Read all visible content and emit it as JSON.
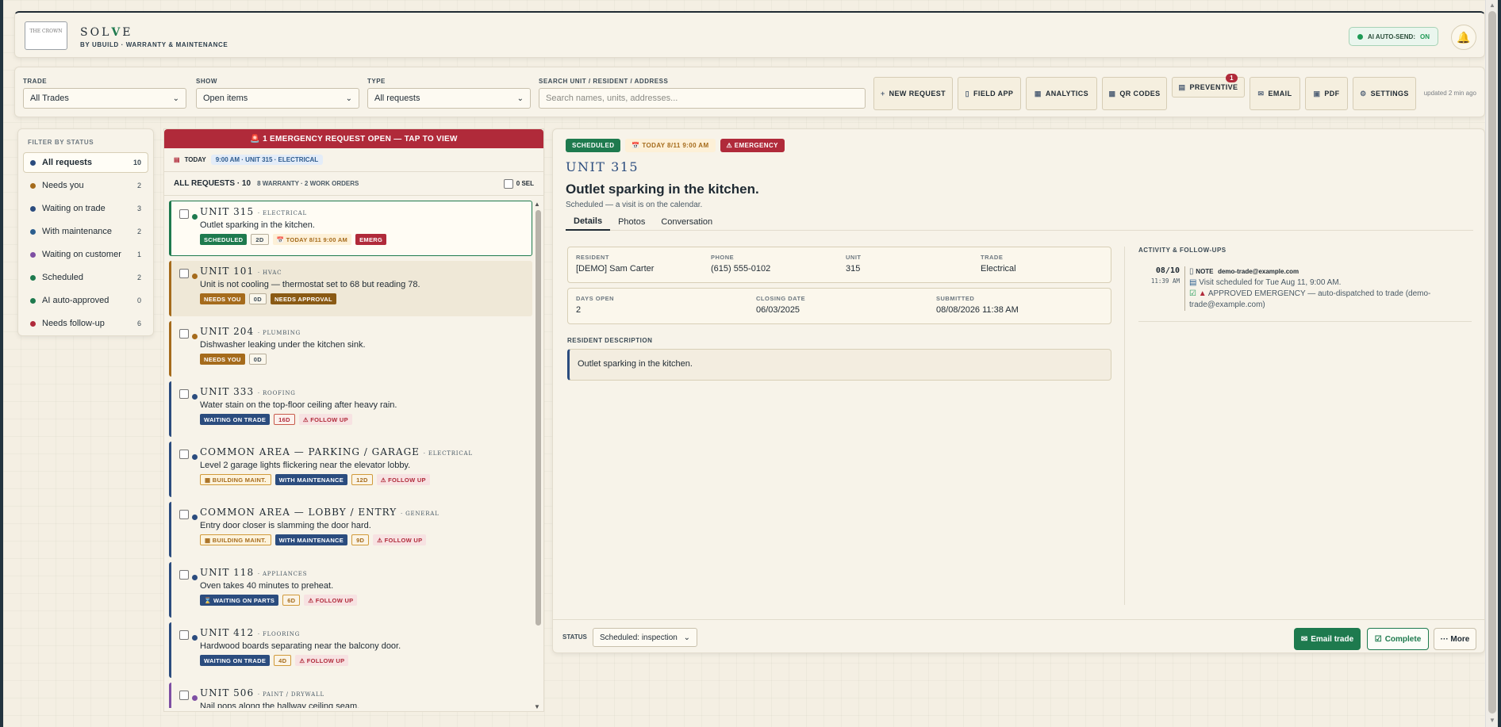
{
  "header": {
    "logo_text": "THE CROWN",
    "brand_prefix": "SOL",
    "brand_mark": "V",
    "brand_suffix": "E",
    "tagline": "BY UBUILD · WARRANTY & MAINTENANCE",
    "ai_label": "AI AUTO-SEND:",
    "ai_state": "ON",
    "bell_icon": "bell-icon"
  },
  "filters": {
    "trade_label": "TRADE",
    "trade_value": "All Trades",
    "show_label": "SHOW",
    "show_value": "Open items",
    "type_label": "TYPE",
    "type_value": "All requests",
    "search_label": "SEARCH UNIT / RESIDENT / ADDRESS",
    "search_placeholder": "Search names, units, addresses..."
  },
  "toolbar": {
    "new_request": "NEW REQUEST",
    "field_app": "FIELD APP",
    "analytics": "ANALYTICS",
    "qr_codes": "QR CODES",
    "preventive": "PREVENTIVE",
    "preventive_badge": "1",
    "email": "EMAIL",
    "pdf": "PDF",
    "settings": "SETTINGS",
    "updated": "updated 2 min ago"
  },
  "status_filter": {
    "title": "FILTER BY STATUS",
    "items": [
      {
        "label": "All requests",
        "count": "10",
        "color": "#2b4c7e"
      },
      {
        "label": "Needs you",
        "count": "2",
        "color": "#a56b1c"
      },
      {
        "label": "Waiting on trade",
        "count": "3",
        "color": "#2b4c7e"
      },
      {
        "label": "With maintenance",
        "count": "2",
        "color": "#2b5e8e"
      },
      {
        "label": "Waiting on customer",
        "count": "1",
        "color": "#7e4fa3"
      },
      {
        "label": "Scheduled",
        "count": "2",
        "color": "#1e7a4e"
      },
      {
        "label": "AI auto-approved",
        "count": "0",
        "color": "#1e7a4e"
      },
      {
        "label": "Needs follow-up",
        "count": "6",
        "color": "#b02a3a"
      }
    ]
  },
  "list": {
    "emergency_banner": "1 EMERGENCY REQUEST OPEN — TAP TO VIEW",
    "today_label": "TODAY",
    "today_chip": "9:00 AM · UNIT 315 · ELECTRICAL",
    "all_label": "ALL REQUESTS · 10",
    "all_sub": "8 WARRANTY · 2 WORK ORDERS",
    "sel_label": "0 SEL",
    "requests": [
      {
        "title": "UNIT 315",
        "trade": "· ELECTRICAL",
        "desc": "Outlet sparking in the kitchen.",
        "dot": "#1e7a4e",
        "tags": [
          {
            "t": "SCHEDULED",
            "c": "t-sched"
          },
          {
            "t": "2D",
            "c": "t-num"
          },
          {
            "t": "📅 TODAY 8/11 9:00 AM",
            "c": "t-today"
          },
          {
            "t": "EMERG",
            "c": "t-emerg"
          }
        ]
      },
      {
        "title": "UNIT 101",
        "trade": "· HVAC",
        "desc": "Unit is not cooling — thermostat set to 68 but reading 78.",
        "dot": "#a56b1c",
        "tags": [
          {
            "t": "NEEDS YOU",
            "c": "t-needs"
          },
          {
            "t": "0D",
            "c": "t-num"
          },
          {
            "t": "NEEDS APPROVAL",
            "c": "t-appr"
          }
        ]
      },
      {
        "title": "UNIT 204",
        "trade": "· PLUMBING",
        "desc": "Dishwasher leaking under the kitchen sink.",
        "dot": "#a56b1c",
        "tags": [
          {
            "t": "NEEDS YOU",
            "c": "t-needs"
          },
          {
            "t": "0D",
            "c": "t-num"
          }
        ]
      },
      {
        "title": "UNIT 333",
        "trade": "· ROOFING",
        "desc": "Water stain on the top-floor ceiling after heavy rain.",
        "dot": "#2b4c7e",
        "tags": [
          {
            "t": "WAITING ON TRADE",
            "c": "t-trade"
          },
          {
            "t": "16D",
            "c": "t-num-red"
          },
          {
            "t": "⚠ FOLLOW UP",
            "c": "t-follow"
          }
        ]
      },
      {
        "title": "COMMON AREA — PARKING / GARAGE",
        "trade": "· ELECTRICAL",
        "desc": "Level 2 garage lights flickering near the elevator lobby.",
        "dot": "#2b4c7e",
        "tags": [
          {
            "t": "▦ BUILDING MAINT.",
            "c": "t-bldg"
          },
          {
            "t": "WITH MAINTENANCE",
            "c": "t-trade"
          },
          {
            "t": "12D",
            "c": "t-num-org"
          },
          {
            "t": "⚠ FOLLOW UP",
            "c": "t-follow"
          }
        ]
      },
      {
        "title": "COMMON AREA — LOBBY / ENTRY",
        "trade": "· GENERAL",
        "desc": "Entry door closer is slamming the door hard.",
        "dot": "#2b4c7e",
        "tags": [
          {
            "t": "▦ BUILDING MAINT.",
            "c": "t-bldg"
          },
          {
            "t": "WITH MAINTENANCE",
            "c": "t-trade"
          },
          {
            "t": "9D",
            "c": "t-num-org"
          },
          {
            "t": "⚠ FOLLOW UP",
            "c": "t-follow"
          }
        ]
      },
      {
        "title": "UNIT 118",
        "trade": "· APPLIANCES",
        "desc": "Oven takes 40 minutes to preheat.",
        "dot": "#2b4c7e",
        "tags": [
          {
            "t": "⌛ WAITING ON PARTS",
            "c": "t-trade"
          },
          {
            "t": "6D",
            "c": "t-num-org"
          },
          {
            "t": "⚠ FOLLOW UP",
            "c": "t-follow"
          }
        ]
      },
      {
        "title": "UNIT 412",
        "trade": "· FLOORING",
        "desc": "Hardwood boards separating near the balcony door.",
        "dot": "#2b4c7e",
        "tags": [
          {
            "t": "WAITING ON TRADE",
            "c": "t-trade"
          },
          {
            "t": "4D",
            "c": "t-num-org"
          },
          {
            "t": "⚠ FOLLOW UP",
            "c": "t-follow"
          }
        ]
      },
      {
        "title": "UNIT 506",
        "trade": "· PAINT / DRYWALL",
        "desc": "Nail pops along the hallway ceiling seam.",
        "dot": "#7e4fa3",
        "tags": []
      }
    ]
  },
  "detail": {
    "tag_status": "SCHEDULED",
    "tag_date": "📅 TODAY 8/11 9:00 AM",
    "tag_emerg": "⚠ EMERGENCY",
    "unit": "UNIT 315",
    "title": "Outlet sparking in the kitchen.",
    "subtitle": "Scheduled — a visit is on the calendar.",
    "tabs": [
      "Details",
      "Photos",
      "Conversation"
    ],
    "resident_label": "RESIDENT",
    "resident": "[DEMO] Sam Carter",
    "phone_label": "PHONE",
    "phone": "(615) 555-0102",
    "unit_label": "UNIT",
    "unit_value": "315",
    "trade_label": "TRADE",
    "trade_value": "Electrical",
    "days_label": "DAYS OPEN",
    "days": "2",
    "closing_label": "CLOSING DATE",
    "closing": "06/03/2025",
    "submitted_label": "SUBMITTED",
    "submitted": "08/08/2026 11:38 AM",
    "desc_label": "RESIDENT DESCRIPTION",
    "desc": "Outlet sparking in the kitchen.",
    "activity_title": "ACTIVITY & FOLLOW-UPS",
    "activity": {
      "date": "08/10",
      "time": "11:39 AM",
      "note_label": "NOTE",
      "note_from": "demo-trade@example.com",
      "line1": "Visit scheduled for Tue Aug 11, 9:00 AM.",
      "line2": "APPROVED EMERGENCY — auto-dispatched to trade (demo-trade@example.com)"
    },
    "status_label": "STATUS",
    "status_value": "Scheduled: inspection",
    "email_trade": "Email trade",
    "complete": "Complete",
    "more": "··· More"
  }
}
